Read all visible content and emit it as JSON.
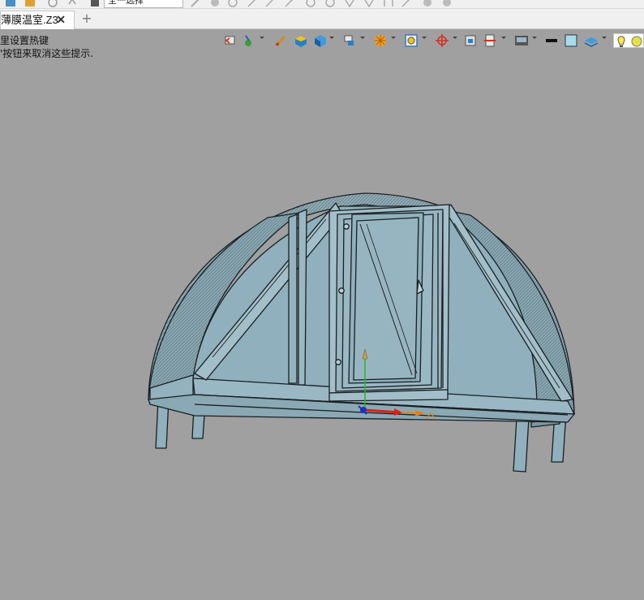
{
  "toolbar": {
    "select_filter": "全一选择"
  },
  "tabs": [
    {
      "label": "薄膜温室.Z3",
      "close": "✕"
    }
  ],
  "new_tab": "+",
  "viewport": {
    "hint_line1": "里设置热键",
    "hint_line2": "'按钮来取消这些提示."
  },
  "colors": {
    "background": "#a0a0a0",
    "model_fill": "#8fb0bc",
    "model_edge": "#1a1f22",
    "axis_red": "#e02010",
    "axis_green": "#30b030",
    "axis_blue": "#2030c0",
    "axis_orange": "#e08020"
  },
  "view_toolbar_icons": [
    "zoom-icon",
    "select-filter-icon",
    "pen-icon",
    "solid-box-icon",
    "box-render-icon",
    "view-cube-icon",
    "sphere-icon",
    "zoom-extents-icon",
    "transform-icon",
    "view-frame-icon",
    "section-icon",
    "display-icon",
    "line-color-icon",
    "face-color-icon",
    "layers-icon",
    "light-bulb-icon",
    "light-icon"
  ]
}
